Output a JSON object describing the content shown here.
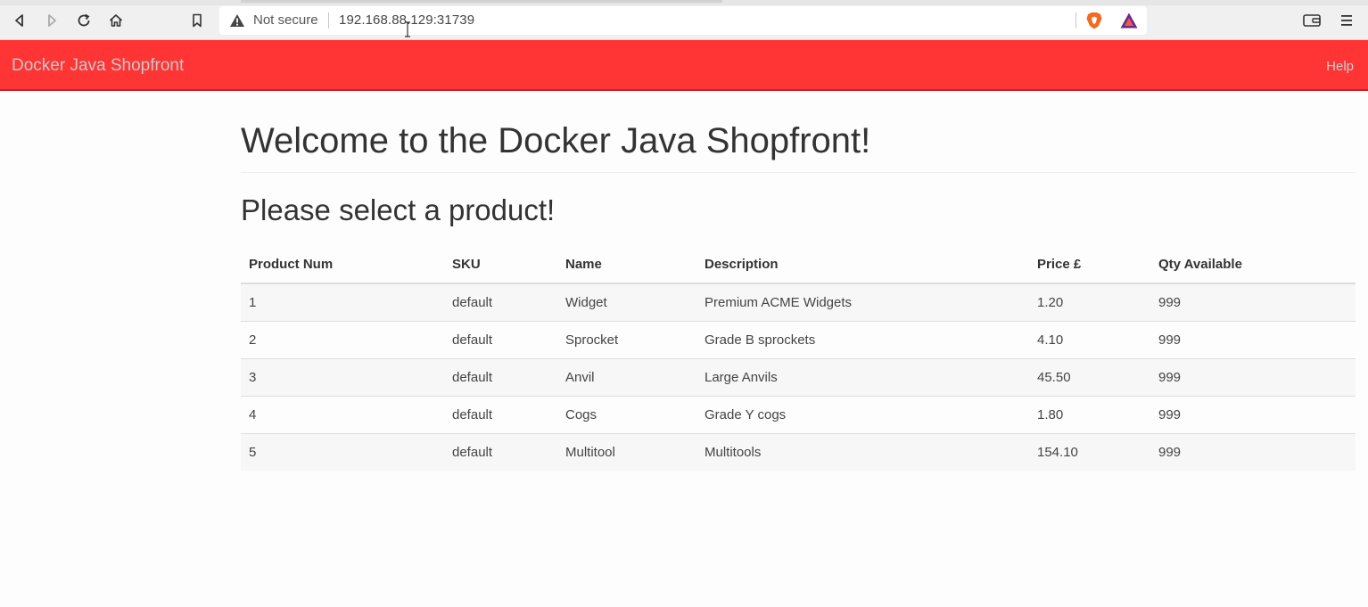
{
  "browser": {
    "security_label": "Not secure",
    "url": "192.168.88.129:31739"
  },
  "navbar": {
    "brand": "Docker Java Shopfront",
    "help": "Help",
    "color": "#ff3434"
  },
  "main": {
    "title": "Welcome to the Docker Java Shopfront!",
    "subtitle": "Please select a product!",
    "table": {
      "headers": [
        "Product Num",
        "SKU",
        "Name",
        "Description",
        "Price £",
        "Qty Available"
      ],
      "rows": [
        {
          "num": "1",
          "sku": "default",
          "name": "Widget",
          "description": "Premium ACME Widgets",
          "price": "1.20",
          "qty": "999"
        },
        {
          "num": "2",
          "sku": "default",
          "name": "Sprocket",
          "description": "Grade B sprockets",
          "price": "4.10",
          "qty": "999"
        },
        {
          "num": "3",
          "sku": "default",
          "name": "Anvil",
          "description": "Large Anvils",
          "price": "45.50",
          "qty": "999"
        },
        {
          "num": "4",
          "sku": "default",
          "name": "Cogs",
          "description": "Grade Y cogs",
          "price": "1.80",
          "qty": "999"
        },
        {
          "num": "5",
          "sku": "default",
          "name": "Multitool",
          "description": "Multitools",
          "price": "154.10",
          "qty": "999"
        }
      ]
    }
  }
}
